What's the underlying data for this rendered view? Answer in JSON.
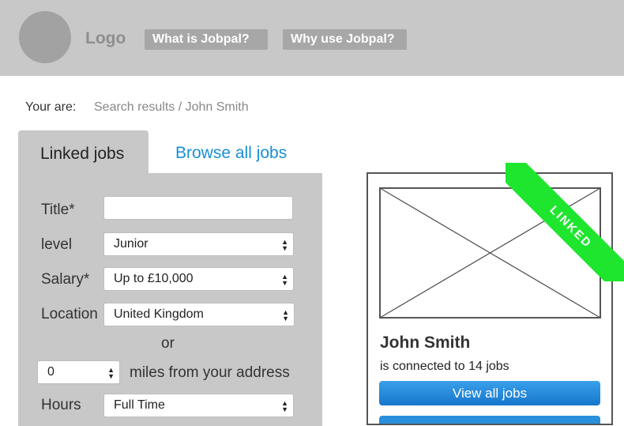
{
  "header": {
    "logo": "Logo",
    "nav": [
      "What is Jobpal?",
      "Why use Jobpal?"
    ]
  },
  "breadcrumb": {
    "label": "Your are:",
    "path": "Search results / John Smith"
  },
  "tabs": {
    "active": "Linked jobs",
    "other": "Browse all jobs"
  },
  "form": {
    "title_label": "Title*",
    "title_value": "",
    "level_label": "level",
    "level_value": "Junior",
    "salary_label": "Salary*",
    "salary_value": "Up to £10,000",
    "location_label": "Location",
    "location_value": "United Kingdom",
    "or": "or",
    "miles_value": "0",
    "miles_label": "miles from your address",
    "hours_label": "Hours",
    "hours_value": "Full Time"
  },
  "card": {
    "ribbon": "LINKED",
    "name": "John Smith",
    "connected": "is connected to 14 jobs",
    "view_button": "View all jobs"
  },
  "colors": {
    "header_bg": "#c8c8c8",
    "link": "#1a8fd4",
    "button": "#1f84d6",
    "ribbon": "#1ee62e"
  }
}
